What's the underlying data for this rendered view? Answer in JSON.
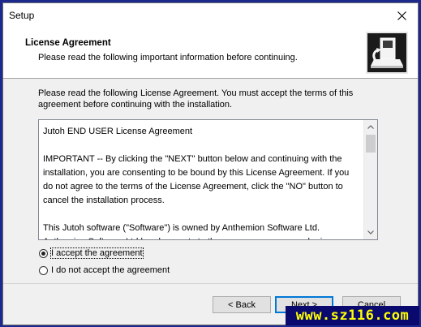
{
  "window": {
    "title": "Setup"
  },
  "header": {
    "title": "License Agreement",
    "subtitle": "Please read the following important information before continuing.",
    "logo_icon": "setup-computer-icon"
  },
  "intro_text": "Please read the following License Agreement. You must accept the terms of this agreement before continuing with the installation.",
  "license": {
    "text": "Jutoh END USER License Agreement\n\nIMPORTANT -- By clicking the \"NEXT\" button below and continuing with the installation, you are consenting to be bound by this License Agreement. If you do not agree to the terms of the License Agreement, click the \"NO\" button to cancel the installation process.\n\nThis Jutoh software (\"Software\") is owned by Anthemion Software Ltd.\nAnthemion Software Ltd hereby grants to the person or company who is"
  },
  "options": {
    "accept_label": "I accept the agreement",
    "decline_label": "I do not accept the agreement",
    "selected": "accept"
  },
  "buttons": {
    "back_label": "< Back",
    "next_label": "Next >",
    "cancel_label": "Cancel"
  },
  "watermark": "www.sz116.com"
}
